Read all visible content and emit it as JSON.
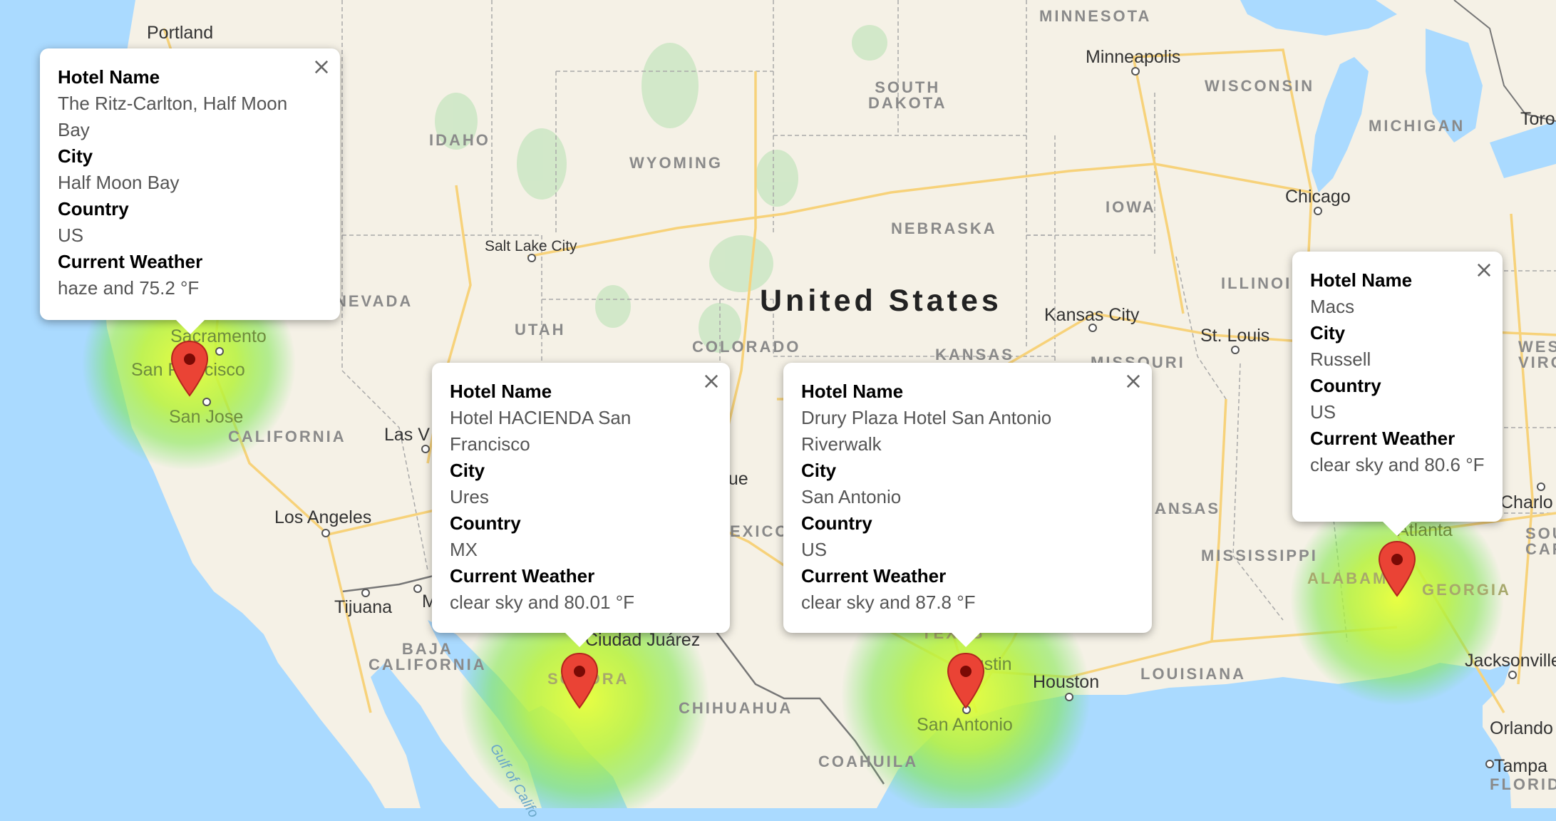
{
  "map": {
    "country_label": "United States",
    "states": [
      {
        "id": "minnesota",
        "text": "MINNESOTA"
      },
      {
        "id": "south-dakota",
        "text": "SOUTH\nDAKOTA"
      },
      {
        "id": "wisconsin",
        "text": "WISCONSIN"
      },
      {
        "id": "michigan",
        "text": "MICHIGAN"
      },
      {
        "id": "idaho",
        "text": "IDAHO"
      },
      {
        "id": "wyoming",
        "text": "WYOMING"
      },
      {
        "id": "nebraska",
        "text": "NEBRASKA"
      },
      {
        "id": "iowa",
        "text": "IOWA"
      },
      {
        "id": "illinois",
        "text": "ILLINOIS"
      },
      {
        "id": "nevada",
        "text": "NEVADA"
      },
      {
        "id": "utah",
        "text": "UTAH"
      },
      {
        "id": "colorado",
        "text": "COLORADO"
      },
      {
        "id": "kansas",
        "text": "KANSAS"
      },
      {
        "id": "missouri",
        "text": "MISSOURI"
      },
      {
        "id": "west-virginia",
        "text": "WEST\nVIRGIN"
      },
      {
        "id": "california",
        "text": "CALIFORNIA"
      },
      {
        "id": "new-mexico",
        "text": "EXICO"
      },
      {
        "id": "arkansas",
        "text": "ANSAS"
      },
      {
        "id": "mississippi",
        "text": "MISSISSIPPI"
      },
      {
        "id": "alabama",
        "text": "ALABAMA"
      },
      {
        "id": "georgia",
        "text": "GEORGIA"
      },
      {
        "id": "south-carolina",
        "text": "SOU\nCARO"
      },
      {
        "id": "baja-california",
        "text": "BAJA\nCALIFORNIA"
      },
      {
        "id": "sonora",
        "text": "SONORA"
      },
      {
        "id": "chihuahua",
        "text": "CHIHUAHUA"
      },
      {
        "id": "coahuila",
        "text": "COAHUILA"
      },
      {
        "id": "louisiana",
        "text": "LOUISIANA"
      },
      {
        "id": "texas",
        "text": "TEXAS"
      },
      {
        "id": "florida",
        "text": "FLORIDA"
      }
    ],
    "cities": [
      {
        "id": "portland",
        "text": "Portland"
      },
      {
        "id": "minneapolis",
        "text": "Minneapolis"
      },
      {
        "id": "toronto",
        "text": "Toron"
      },
      {
        "id": "chicago",
        "text": "Chicago"
      },
      {
        "id": "salt-lake-city",
        "text": "Salt Lake City"
      },
      {
        "id": "kansas-city",
        "text": "Kansas City"
      },
      {
        "id": "st-louis",
        "text": "St. Louis"
      },
      {
        "id": "sacramento",
        "text": "Sacramento"
      },
      {
        "id": "san-francisco",
        "text": "San Francisco"
      },
      {
        "id": "san-jose",
        "text": "San Jose"
      },
      {
        "id": "las-vegas",
        "text": "Las V"
      },
      {
        "id": "albuquerque",
        "text": "que"
      },
      {
        "id": "los-angeles",
        "text": "Los Angeles"
      },
      {
        "id": "tijuana",
        "text": "Tijuana"
      },
      {
        "id": "mexicali",
        "text": "M"
      },
      {
        "id": "ciudad-juarez",
        "text": "Ciudad Juárez"
      },
      {
        "id": "austin",
        "text": "Austin"
      },
      {
        "id": "houston",
        "text": "Houston"
      },
      {
        "id": "san-antonio",
        "text": "San Antonio"
      },
      {
        "id": "atlanta",
        "text": "Atlanta"
      },
      {
        "id": "charlotte",
        "text": "Charlo"
      },
      {
        "id": "jacksonville",
        "text": "Jacksonville"
      },
      {
        "id": "orlando",
        "text": "Orlando"
      },
      {
        "id": "tampa",
        "text": "Tampa"
      },
      {
        "id": "gulf-of-california",
        "text": "Gulf of Califo"
      }
    ]
  },
  "info_windows": [
    {
      "id": "half-moon-bay",
      "labels": {
        "hotel": "Hotel Name",
        "city": "City",
        "country": "Country",
        "weather": "Current Weather"
      },
      "hotel": "The Ritz-Carlton, Half Moon Bay",
      "city": "Half Moon Bay",
      "country": "US",
      "weather": "haze and 75.2 °F"
    },
    {
      "id": "ures",
      "labels": {
        "hotel": "Hotel Name",
        "city": "City",
        "country": "Country",
        "weather": "Current Weather"
      },
      "hotel": "Hotel HACIENDA San Francisco",
      "city": "Ures",
      "country": "MX",
      "weather": "clear sky and 80.01 °F"
    },
    {
      "id": "san-antonio",
      "labels": {
        "hotel": "Hotel Name",
        "city": "City",
        "country": "Country",
        "weather": "Current Weather"
      },
      "hotel": "Drury Plaza Hotel San Antonio Riverwalk",
      "city": "San Antonio",
      "country": "US",
      "weather": "clear sky and 87.8 °F"
    },
    {
      "id": "russell",
      "labels": {
        "hotel": "Hotel Name",
        "city": "City",
        "country": "Country",
        "weather": "Current Weather"
      },
      "hotel": "Macs",
      "city": "Russell",
      "country": "US",
      "weather": "clear sky and 80.6 °F"
    }
  ],
  "colors": {
    "water": "#aadaff",
    "land": "#f5f1e6",
    "road": "#f7d27a",
    "marker": "#ea4335",
    "heat": "#7fff00"
  },
  "icons": {
    "close": "close-icon",
    "marker": "map-pin-icon"
  }
}
